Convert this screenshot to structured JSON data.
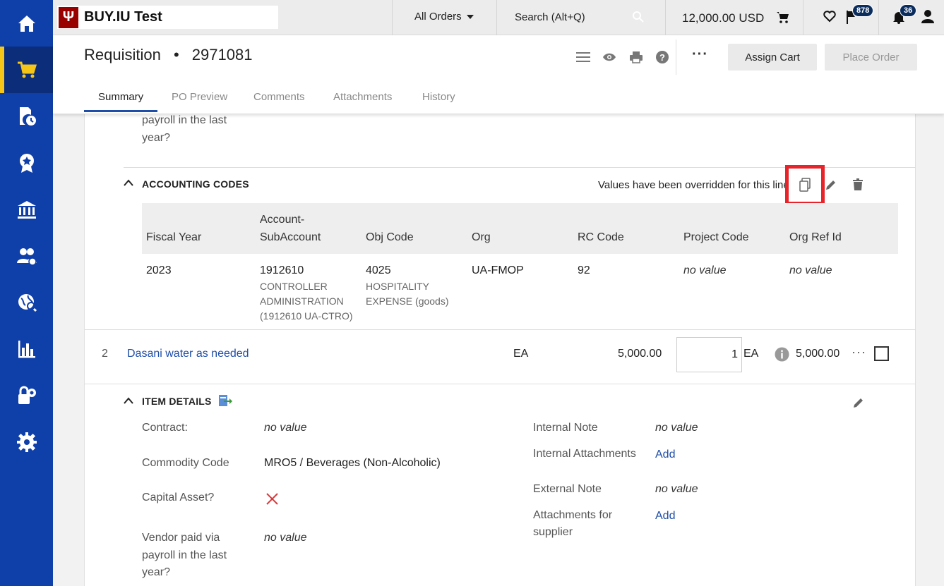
{
  "topbar": {
    "app_name": "BUY.IU Test",
    "logo_mark": "Ψ",
    "all_orders": "All Orders",
    "search_placeholder": "Search (Alt+Q)",
    "cart_total": "12,000.00 USD",
    "flag_badge": "878",
    "bell_badge": "36"
  },
  "sidebar": {
    "items": [
      {
        "icon": "home-icon"
      },
      {
        "icon": "cart-icon",
        "active": true
      },
      {
        "icon": "document-clock-icon"
      },
      {
        "icon": "award-icon"
      },
      {
        "icon": "bank-icon"
      },
      {
        "icon": "users-icon"
      },
      {
        "icon": "globe-icon"
      },
      {
        "icon": "bar-chart-icon"
      },
      {
        "icon": "lock-gear-icon"
      },
      {
        "icon": "settings-icon"
      }
    ]
  },
  "header": {
    "title": "Requisition",
    "separator": "•",
    "number": "2971081",
    "more": "···",
    "assign_cart": "Assign Cart",
    "place_order": "Place Order"
  },
  "tabs": [
    "Summary",
    "PO Preview",
    "Comments",
    "Attachments",
    "History"
  ],
  "top_fragment": {
    "line1": "payroll in the last",
    "line2": "year?"
  },
  "accounting": {
    "heading": "ACCOUNTING CODES",
    "override_note": "Values have been overridden for this line",
    "columns": {
      "fiscal_year": "Fiscal Year",
      "account_line1": "Account-",
      "account_line2": "SubAccount",
      "obj_code": "Obj Code",
      "org": "Org",
      "rc_code": "RC Code",
      "project_code": "Project Code",
      "org_ref_id": "Org Ref Id"
    },
    "row": {
      "fiscal_year": "2023",
      "account": "1912610",
      "account_desc1": "CONTROLLER",
      "account_desc2": "ADMINISTRATION",
      "account_desc3": "(1912610 UA-CTRO)",
      "obj_code": "4025",
      "obj_desc1": "HOSPITALITY",
      "obj_desc2": "EXPENSE (goods)",
      "org": "UA-FMOP",
      "rc_code": "92",
      "project_code": "no value",
      "org_ref_id": "no value"
    }
  },
  "line2": {
    "number": "2",
    "name": "Dasani water as needed",
    "uom": "EA",
    "unit_price": "5,000.00",
    "quantity": "1",
    "qty_uom": "EA",
    "total": "5,000.00",
    "more": "···"
  },
  "item_details": {
    "heading": "ITEM DETAILS",
    "contract_label": "Contract:",
    "contract_value": "no value",
    "commodity_label": "Commodity Code",
    "commodity_value": "MRO5 / Beverages (Non-Alcoholic)",
    "capital_label": "Capital Asset?",
    "vendor_line1": "Vendor paid via",
    "vendor_line2": "payroll in the last",
    "vendor_line3": "year?",
    "vendor_value": "no value",
    "internal_note_label": "Internal Note",
    "internal_note_value": "no value",
    "internal_attach_label": "Internal Attachments",
    "internal_attach_action": "Add",
    "external_note_label": "External Note",
    "external_note_value": "no value",
    "supplier_attach_line1": "Attachments for",
    "supplier_attach_line2": "supplier",
    "supplier_attach_action": "Add"
  },
  "colors": {
    "sidebar": "#0f3fa8",
    "accent": "#f5c518",
    "link": "#1f4ea8",
    "highlight": "#e8242b",
    "brand": "#990000"
  }
}
